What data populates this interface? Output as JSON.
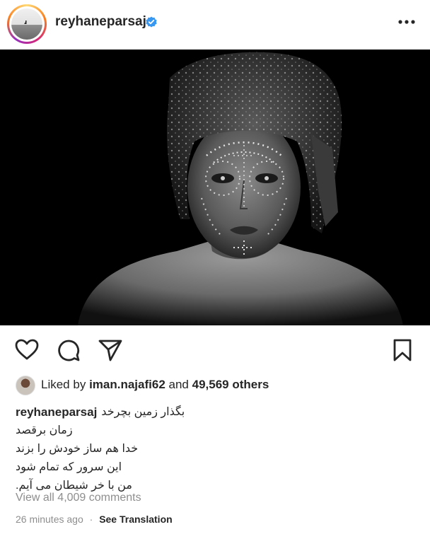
{
  "post": {
    "username": "reyhaneparsaj",
    "verified": true,
    "accent_verified": "#3897f0",
    "icons": {
      "more": "more-horizontal-icon",
      "like": "heart-icon",
      "comment": "comment-icon",
      "share": "send-icon",
      "save": "bookmark-icon"
    },
    "likes": {
      "prefix": "Liked by",
      "liker": "iman.najafi62",
      "joiner": "and",
      "others": "49,569 others"
    },
    "caption": {
      "user": "reyhaneparsaj",
      "lines": [
        "بگذار زمین بچرخد",
        "زمان برقصد",
        "خدا هم ساز خودش را بزند",
        "این سرور که تمام شود",
        "من با خر شیطان می آیم."
      ]
    },
    "view_all_comments": "View all 4,009 comments",
    "timestamp": "26 minutes ago",
    "separator": "·",
    "see_translation": "See Translation"
  }
}
